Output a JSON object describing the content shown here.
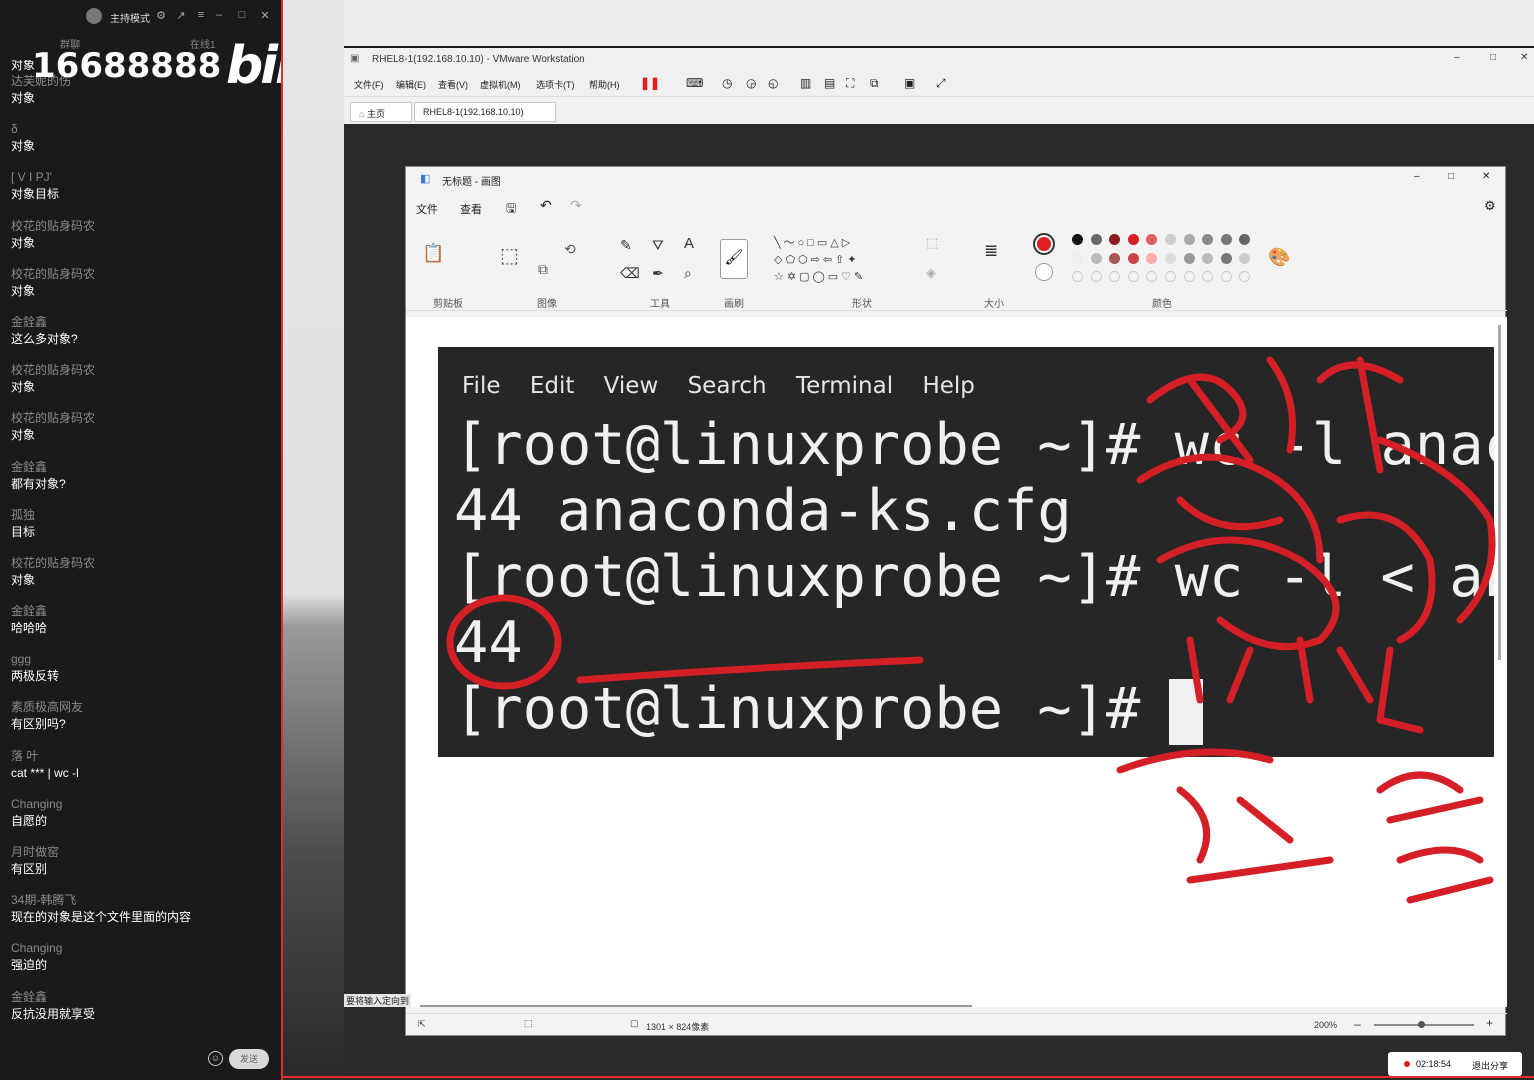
{
  "chat": {
    "mode_label": "主持模式",
    "tab_chat": "群聊",
    "tab_online": "在线1",
    "user_id": "16688888",
    "logo": "bilibili",
    "first_text": "对象",
    "messages": [
      {
        "user": "达芙妮的伤",
        "text": "对象"
      },
      {
        "user": "δ",
        "text": "对象"
      },
      {
        "user": "[ V I PJ'",
        "text": "对象目标"
      },
      {
        "user": "校花的贴身码农",
        "text": "对象"
      },
      {
        "user": "校花的贴身码农",
        "text": "对象"
      },
      {
        "user": "金銓鑫",
        "text": "这么多对象?"
      },
      {
        "user": "校花的贴身码农",
        "text": "对象"
      },
      {
        "user": "校花的贴身码农",
        "text": "对象"
      },
      {
        "user": "金銓鑫",
        "text": "都有对象?"
      },
      {
        "user": "孤独",
        "text": "目标"
      },
      {
        "user": "校花的贴身码农",
        "text": "对象"
      },
      {
        "user": "金銓鑫",
        "text": "哈哈哈"
      },
      {
        "user": "ggg",
        "text": "两极反转"
      },
      {
        "user": "素质极高网友",
        "text": "有区别吗?"
      },
      {
        "user": "落 叶",
        "text": "cat *** | wc -l"
      },
      {
        "user": "Changing",
        "text": "自愿的"
      },
      {
        "user": "月时做窑",
        "text": "有区别"
      },
      {
        "user": "34期-韩腾飞",
        "text": "现在的对象是这个文件里面的内容"
      },
      {
        "user": "Changing",
        "text": "强迫的"
      },
      {
        "user": "金銓鑫",
        "text": "反抗没用就享受"
      }
    ],
    "send_label": "发送"
  },
  "vmware": {
    "title": "RHEL8-1(192.168.10.10) - VMware Workstation",
    "menu": [
      "文件(F)",
      "编辑(E)",
      "查看(V)",
      "虚拟机(M)",
      "选项卡(T)",
      "帮助(H)"
    ],
    "tabs": [
      "主页",
      "RHEL8-1(192.168.10.10)"
    ]
  },
  "paint": {
    "title": "无标题 - 画图",
    "menu": [
      "文件",
      "查看"
    ],
    "groups": [
      "剪贴板",
      "图像",
      "工具",
      "画刷",
      "形状",
      "大小",
      "颜色"
    ],
    "status_size": "1301 × 824像素",
    "zoom": "200%",
    "primary_color": "#e02020"
  },
  "terminal": {
    "menu": [
      "File",
      "Edit",
      "View",
      "Search",
      "Terminal",
      "Help"
    ],
    "lines": [
      "[root@linuxprobe ~]# wc -l anac",
      "44 anaconda-ks.cfg",
      "[root@linuxprobe ~]# wc -l < an",
      "44",
      "[root@linuxprobe ~]# "
    ]
  },
  "ime_text": "要将输入定向到",
  "recording": {
    "time": "02:18:54",
    "exit_label": "退出分享"
  }
}
